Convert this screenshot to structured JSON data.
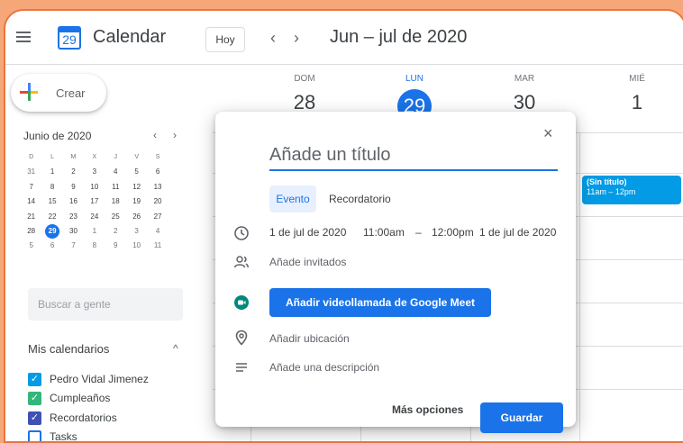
{
  "header": {
    "app_title": "Calendar",
    "logo_day": "29",
    "today_label": "Hoy",
    "prev": "‹",
    "next": "›",
    "date_range": "Jun – jul de 2020"
  },
  "sidebar": {
    "create_label": "Crear",
    "mini_calendar": {
      "title": "Junio de 2020",
      "prev": "‹",
      "next": "›",
      "weekdays": [
        "D",
        "L",
        "M",
        "X",
        "J",
        "V",
        "S"
      ],
      "weeks": [
        [
          "31",
          "1",
          "2",
          "3",
          "4",
          "5",
          "6"
        ],
        [
          "7",
          "8",
          "9",
          "10",
          "11",
          "12",
          "13"
        ],
        [
          "14",
          "15",
          "16",
          "17",
          "18",
          "19",
          "20"
        ],
        [
          "21",
          "22",
          "23",
          "24",
          "25",
          "26",
          "27"
        ],
        [
          "28",
          "29",
          "30",
          "1",
          "2",
          "3",
          "4"
        ],
        [
          "5",
          "6",
          "7",
          "8",
          "9",
          "10",
          "11"
        ]
      ],
      "selected": "29"
    },
    "people_search_placeholder": "Buscar a gente",
    "my_calendars_title": "Mis calendarios",
    "my_calendars_chevron": "^",
    "calendars": [
      {
        "name": "Pedro Vidal Jimenez",
        "color": "#039be5",
        "checked": true
      },
      {
        "name": "Cumpleaños",
        "color": "#33b679",
        "checked": true
      },
      {
        "name": "Recordatorios",
        "color": "#3f51b5",
        "checked": true
      },
      {
        "name": "Tasks",
        "color": "#1a73e8",
        "checked": false
      }
    ]
  },
  "days": [
    {
      "dow": "DOM",
      "num": "28"
    },
    {
      "dow": "LUN",
      "num": "29",
      "today": true
    },
    {
      "dow": "MAR",
      "num": "30"
    },
    {
      "dow": "MIÉ",
      "num": "1"
    }
  ],
  "event_chip": {
    "title": "(Sin título)",
    "time": "11am – 12pm"
  },
  "dialog": {
    "close": "×",
    "title_placeholder": "Añade un título",
    "tab_event": "Evento",
    "tab_reminder": "Recordatorio",
    "start_date": "1 de jul de 2020",
    "start_time": "11:00am",
    "dash": "–",
    "end_time": "12:00pm",
    "end_date": "1 de jul de 2020",
    "guests": "Añade invitados",
    "meet_button": "Añadir videollamada de Google Meet",
    "location": "Añadir ubicación",
    "description": "Añade una descripción",
    "more_options": "Más opciones",
    "save": "Guardar"
  },
  "colors": {
    "accent": "#1a73e8",
    "frame_border": "#e8763c",
    "background": "#f6a77a",
    "event_chip": "#039be5",
    "meet_green": "#00897b"
  }
}
